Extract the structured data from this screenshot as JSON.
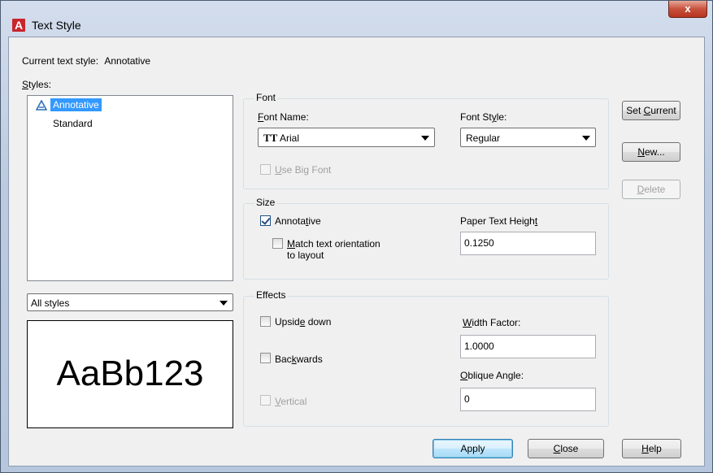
{
  "window": {
    "title": "Text Style",
    "close_glyph": "x",
    "app_icon_letter": "A"
  },
  "current_style": {
    "label": "Current text style:",
    "value": "Annotative"
  },
  "styles": {
    "label": "Styles:",
    "items": [
      {
        "label": "Annotative",
        "selected": true,
        "icon": "annotative-icon"
      },
      {
        "label": "Standard",
        "selected": false
      }
    ],
    "filter": "All styles"
  },
  "preview": {
    "text": "AaBb123"
  },
  "font": {
    "group_label": "Font",
    "name_label": "Font Name:",
    "name_value": "Arial",
    "name_icon": "truetype-font-icon",
    "style_label": "Font Style:",
    "style_value": "Regular",
    "big_font_label": "Use Big Font",
    "big_font_checked": false
  },
  "size": {
    "group_label": "Size",
    "annotative_label": "Annotative",
    "annotative_checked": true,
    "match_label_line1": "Match text orientation",
    "match_label_line2": "to layout",
    "match_checked": false,
    "height_label": "Paper Text Height",
    "height_value": "0.1250"
  },
  "effects": {
    "group_label": "Effects",
    "upside_down_label": "Upside down",
    "backwards_label": "Backwards",
    "vertical_label": "Vertical",
    "width_factor_label": "Width Factor:",
    "width_factor_value": "1.0000",
    "oblique_label": "Oblique Angle:",
    "oblique_value": "0"
  },
  "buttons": {
    "set_current": "Set Current",
    "new": "New...",
    "delete": "Delete",
    "apply": "Apply",
    "close": "Close",
    "help": "Help"
  },
  "colors": {
    "selection": "#3399ff",
    "title_gradient": "#bccadf",
    "close_red": "#c8523d"
  }
}
